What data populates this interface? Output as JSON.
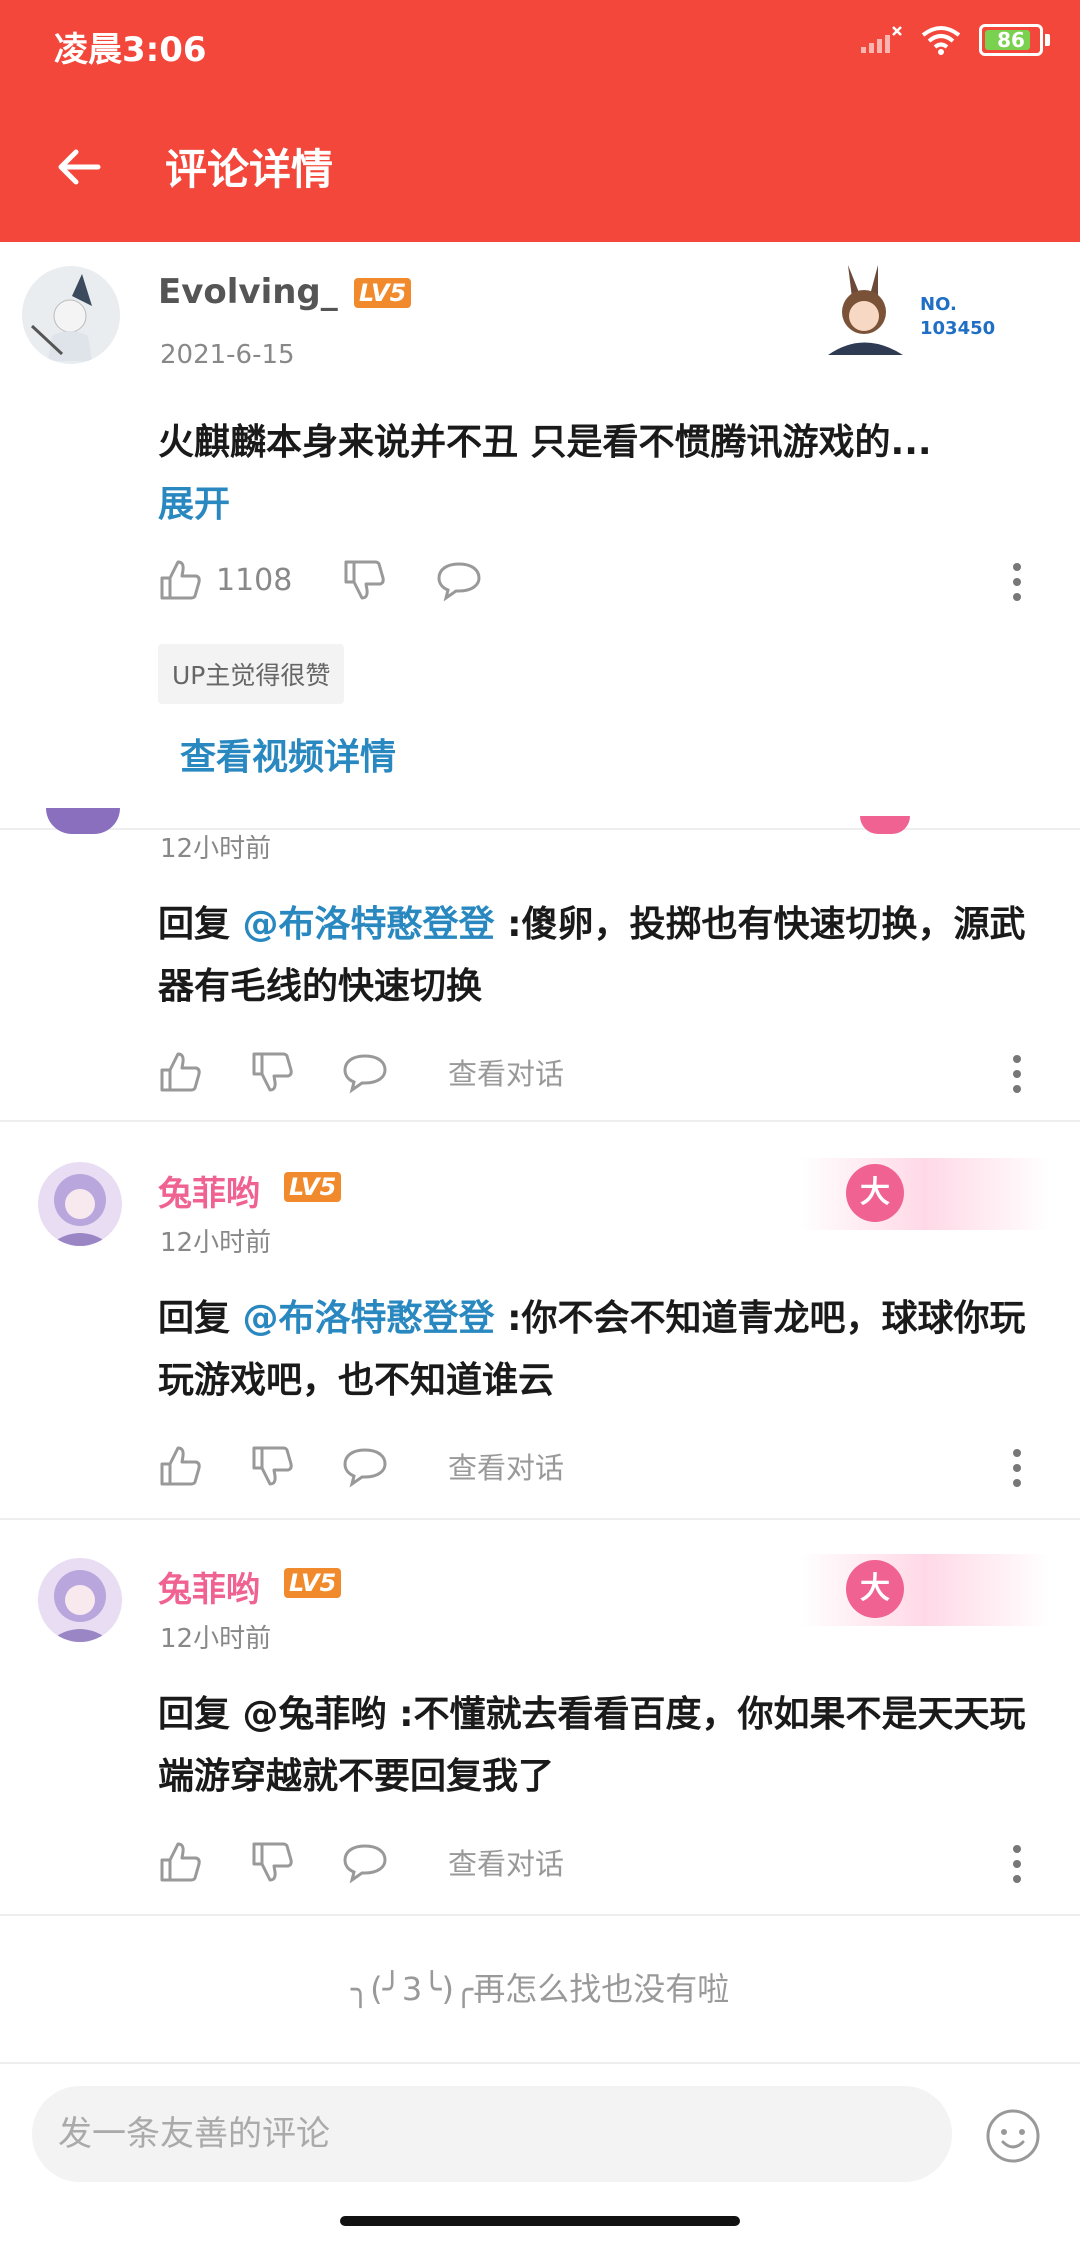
{
  "status": {
    "time": "凌晨3:06",
    "battery": "86"
  },
  "header": {
    "title": "评论详情"
  },
  "main_comment": {
    "username": "Evolving_",
    "level": "LV5",
    "date": "2021-6-15",
    "badge_no": "NO.",
    "badge_num": "103450",
    "text": "火麒麟本身来说并不丑  只是看不惯腾讯游戏的...",
    "expand": "展开",
    "likes": "1108",
    "tag": "UP主觉得很赞",
    "view_video": "查看视频详情"
  },
  "replies": [
    {
      "time": "12小时前",
      "prefix": "回复 ",
      "mention": "@布洛特憨登登",
      "text": " :傻卵，投掷也有快速切换，源武器有毛线的快速切换",
      "view_conv": "查看对话"
    },
    {
      "username": "兔菲哟",
      "level": "LV5",
      "badge": "大",
      "time": "12小时前",
      "prefix": "回复 ",
      "mention": "@布洛特憨登登",
      "text": " :你不会不知道青龙吧，球球你玩玩游戏吧，也不知道谁云",
      "view_conv": "查看对话"
    },
    {
      "username": "兔菲哟",
      "level": "LV5",
      "badge": "大",
      "time": "12小时前",
      "prefix": "回复 ",
      "mention": "",
      "text": "@兔菲哟 :不懂就去看看百度，你如果不是天天玩端游穿越就不要回复我了",
      "view_conv": "查看对话"
    }
  ],
  "footer": {
    "end_text": "╮(╯3╰)╭再怎么找也没有啦"
  },
  "input": {
    "placeholder": "发一条友善的评论"
  },
  "colors": {
    "accent": "#f2473a",
    "link": "#2a88c0",
    "name_pink": "#f06292"
  }
}
